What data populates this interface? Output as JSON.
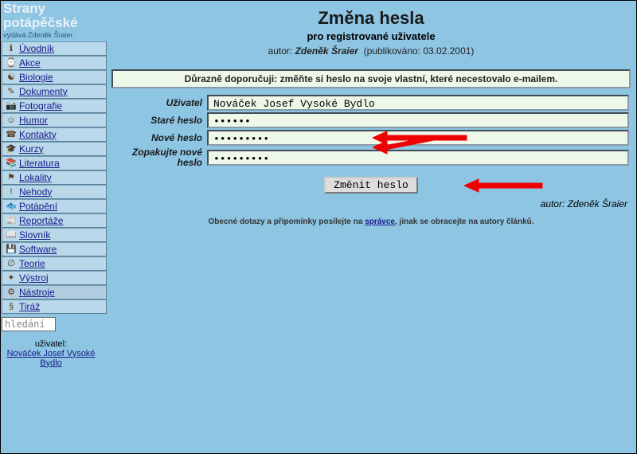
{
  "site": {
    "title_line1": "Strany",
    "title_line2": "potápěčské",
    "publisher": "vydává Zdeněk Šraier"
  },
  "menu": [
    {
      "icon": "ℹ",
      "label": "Úvodník"
    },
    {
      "icon": "⌚",
      "label": "Akce"
    },
    {
      "icon": "☯",
      "label": "Biologie"
    },
    {
      "icon": "✎",
      "label": "Dokumenty"
    },
    {
      "icon": "📷",
      "label": "Fotografie"
    },
    {
      "icon": "☺",
      "label": "Humor"
    },
    {
      "icon": "☎",
      "label": "Kontakty"
    },
    {
      "icon": "🎓",
      "label": "Kurzy"
    },
    {
      "icon": "📚",
      "label": "Literatura"
    },
    {
      "icon": "⚑",
      "label": "Lokality"
    },
    {
      "icon": "!",
      "label": "Nehody"
    },
    {
      "icon": "🐟",
      "label": "Potápění"
    },
    {
      "icon": "📰",
      "label": "Reportáže"
    },
    {
      "icon": "📖",
      "label": "Slovník"
    },
    {
      "icon": "💾",
      "label": "Software"
    },
    {
      "icon": "∅",
      "label": "Teorie"
    },
    {
      "icon": "✦",
      "label": "Výstroj"
    },
    {
      "icon": "⚙",
      "label": "Nástroje"
    },
    {
      "icon": "§",
      "label": "Tiráž"
    }
  ],
  "search": {
    "placeholder": "hledání"
  },
  "user": {
    "label": "uživatel:",
    "name": "Nováček Josef Vysoké Bydlo"
  },
  "page": {
    "title": "Změna hesla",
    "subtitle": "pro registrované uživatele",
    "byline_label": "autor:",
    "byline_author": "Zdeněk Šraier",
    "byline_date_label": "(publikováno:",
    "byline_date": "03.02.2001)",
    "warning": "Důrazně doporučuji: změňte si heslo na svoje vlastní, které necestovalo e-mailem.",
    "labels": {
      "user": "Uživatel",
      "old": "Staré heslo",
      "new": "Nové heslo",
      "repeat": "Zopakujte nové heslo"
    },
    "values": {
      "user": "Nováček Josef Vysoké Bydlo",
      "old": "••••••",
      "new": "•••••••••",
      "repeat": "•••••••••"
    },
    "submit": "Změnit heslo",
    "author_line": "autor: Zdeněk Šraier",
    "footer_before": "Obecné dotazy a připomínky posílejte na ",
    "footer_link": "správce",
    "footer_after": ", jinak se obracejte na autory článků."
  }
}
